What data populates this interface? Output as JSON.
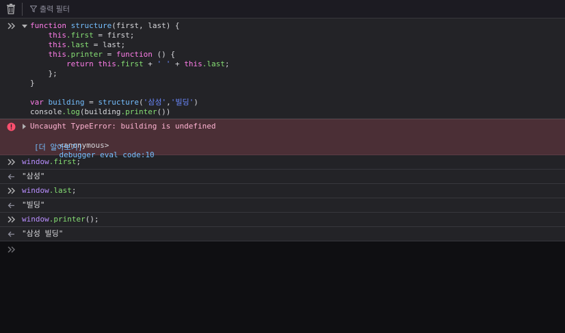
{
  "toolbar": {
    "filter_label": "출력 필터"
  },
  "code_block": {
    "lines": [
      [
        {
          "t": "function ",
          "c": "kw"
        },
        {
          "t": "structure",
          "c": "fn"
        },
        {
          "t": "(first, last) {",
          "c": "plain"
        }
      ],
      [
        {
          "t": "    this",
          "c": "kw"
        },
        {
          "t": ".first",
          "c": "prop"
        },
        {
          "t": " = first;",
          "c": "plain"
        }
      ],
      [
        {
          "t": "    this",
          "c": "kw"
        },
        {
          "t": ".last",
          "c": "prop"
        },
        {
          "t": " = last;",
          "c": "plain"
        }
      ],
      [
        {
          "t": "    this",
          "c": "kw"
        },
        {
          "t": ".printer",
          "c": "prop"
        },
        {
          "t": " = ",
          "c": "plain"
        },
        {
          "t": "function",
          "c": "kw"
        },
        {
          "t": " () {",
          "c": "plain"
        }
      ],
      [
        {
          "t": "        return ",
          "c": "kw"
        },
        {
          "t": "this",
          "c": "kw"
        },
        {
          "t": ".first",
          "c": "prop"
        },
        {
          "t": " + ",
          "c": "plain"
        },
        {
          "t": "' '",
          "c": "str"
        },
        {
          "t": " + ",
          "c": "plain"
        },
        {
          "t": "this",
          "c": "kw"
        },
        {
          "t": ".last",
          "c": "prop"
        },
        {
          "t": ";",
          "c": "plain"
        }
      ],
      [
        {
          "t": "    };",
          "c": "plain"
        }
      ],
      [
        {
          "t": "}",
          "c": "plain"
        }
      ],
      [
        {
          "t": "",
          "c": "plain"
        }
      ],
      [
        {
          "t": "var ",
          "c": "kw"
        },
        {
          "t": "building",
          "c": "fn"
        },
        {
          "t": " = ",
          "c": "plain"
        },
        {
          "t": "structure",
          "c": "fn"
        },
        {
          "t": "(",
          "c": "plain"
        },
        {
          "t": "'삼성'",
          "c": "str"
        },
        {
          "t": ",",
          "c": "plain"
        },
        {
          "t": "'빌딩'",
          "c": "str"
        },
        {
          "t": ")",
          "c": "plain"
        }
      ],
      [
        {
          "t": "console",
          "c": "plain"
        },
        {
          "t": ".log",
          "c": "prop"
        },
        {
          "t": "(building",
          "c": "plain"
        },
        {
          "t": ".printer",
          "c": "prop"
        },
        {
          "t": "())",
          "c": "plain"
        }
      ]
    ]
  },
  "error": {
    "message": "Uncaught TypeError: building is undefined",
    "frame_name": "<anonymous>",
    "frame_location": "debugger eval code:10",
    "learn_more": "[더 알아보기]"
  },
  "entries": [
    {
      "input_obj": "window",
      "input_prop": ".first",
      "input_tail": ";",
      "output": "\"삼성\""
    },
    {
      "input_obj": "window",
      "input_prop": ".last",
      "input_tail": ";",
      "output": "\"빌딩\""
    },
    {
      "input_obj": "window",
      "input_prop": ".printer",
      "input_tail": "();",
      "output": "\"삼성 빌딩\""
    }
  ],
  "colors": {
    "keyword": "#ff7de9",
    "function": "#75bfff",
    "property": "#86de74",
    "string": "#6b89ff",
    "error_bg": "#4b2f36",
    "error_icon": "#ff4f6e"
  },
  "icons": [
    "trash-icon",
    "filter-icon",
    "prompt-chevron-icon",
    "collapse-triangle-icon",
    "error-icon",
    "expand-triangle-icon",
    "result-arrow-icon"
  ]
}
